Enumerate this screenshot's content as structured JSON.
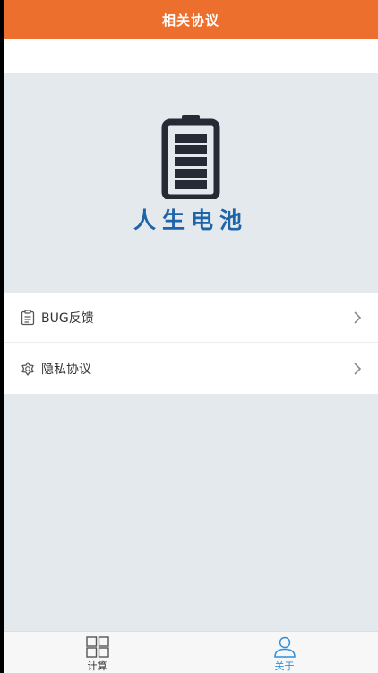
{
  "header": {
    "title": "相关协议"
  },
  "banner": {
    "brand_name": "人生电池",
    "brand_color": "#1f63a8",
    "icon": "battery-icon"
  },
  "menu": {
    "items": [
      {
        "label": "BUG反馈",
        "icon": "feedback-icon"
      },
      {
        "label": "隐私协议",
        "icon": "privacy-icon"
      }
    ]
  },
  "tabbar": {
    "tabs": [
      {
        "label": "计算",
        "icon": "grid-icon",
        "active": false
      },
      {
        "label": "关于",
        "icon": "user-icon",
        "active": true
      }
    ]
  },
  "colors": {
    "header_bg": "#ed6f2d",
    "page_bg": "#e3e9ec",
    "active_tab": "#2f8fdc"
  }
}
